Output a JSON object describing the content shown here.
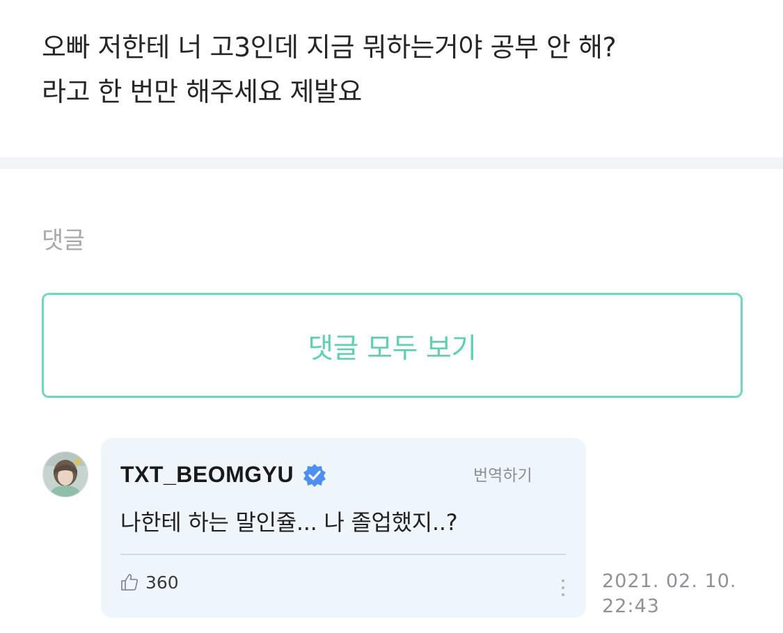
{
  "post": {
    "text_line1": "오빠 저한테 너 고3인데 지금 뭐하는거야 공부 안 해?",
    "text_line2": "라고 한 번만 해주세요 제발요"
  },
  "comments_section": {
    "label": "댓글",
    "view_all_label": "댓글 모두 보기"
  },
  "comment": {
    "author": "TXT_BEOMGYU",
    "verified_icon": "verified-badge-icon",
    "translate_label": "번역하기",
    "text": "나한테 하는 말인쥴... 나 졸업했지..?",
    "like_count": "360",
    "date": "2021. 02. 10.",
    "time": "22:43"
  },
  "colors": {
    "accent": "#5fd0b3",
    "verified": "#4d8ff3",
    "bubble": "#eef6fc"
  }
}
